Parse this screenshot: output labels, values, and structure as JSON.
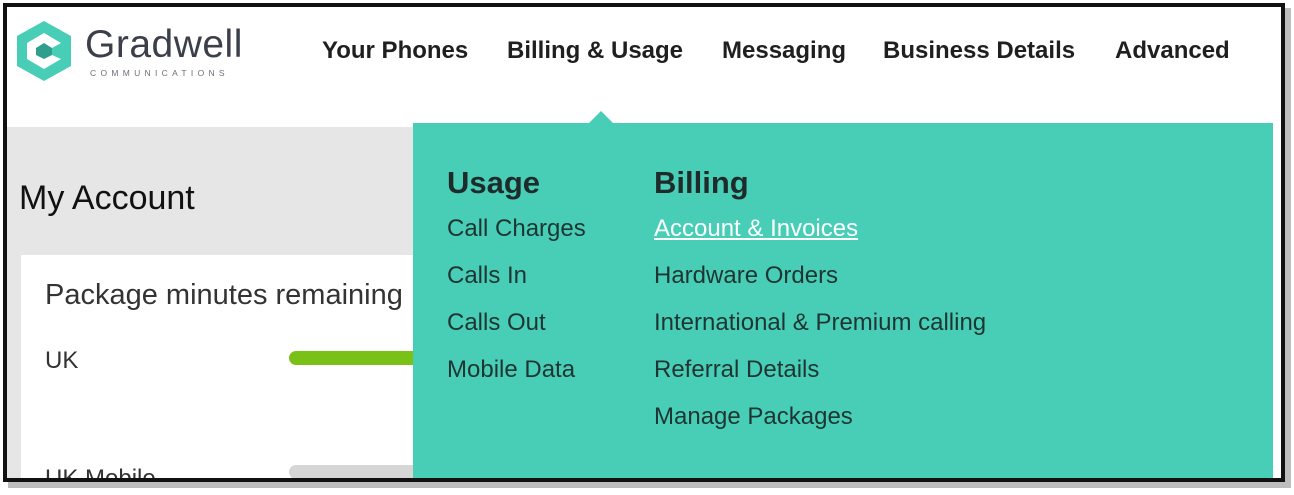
{
  "brand": {
    "name": "Gradwell",
    "tagline": "COMMUNICATIONS",
    "accent_color": "#48ceb6"
  },
  "nav": {
    "items": [
      "Your Phones",
      "Billing & Usage",
      "Messaging",
      "Business Details",
      "Advanced"
    ]
  },
  "page": {
    "title": "My Account"
  },
  "card": {
    "title": "Package minutes remaining",
    "rows": [
      {
        "label": "UK",
        "fill": 0.9,
        "color": "#79c017"
      },
      {
        "label": "UK Mobile",
        "fill": 0.0,
        "color": "#79c017"
      }
    ]
  },
  "dropdown": {
    "usage": {
      "heading": "Usage",
      "links": [
        "Call Charges",
        "Calls In",
        "Calls Out",
        "Mobile Data"
      ]
    },
    "billing": {
      "heading": "Billing",
      "links": [
        "Account & Invoices",
        "Hardware Orders",
        "International & Premium calling",
        "Referral Details",
        "Manage Packages"
      ]
    }
  }
}
